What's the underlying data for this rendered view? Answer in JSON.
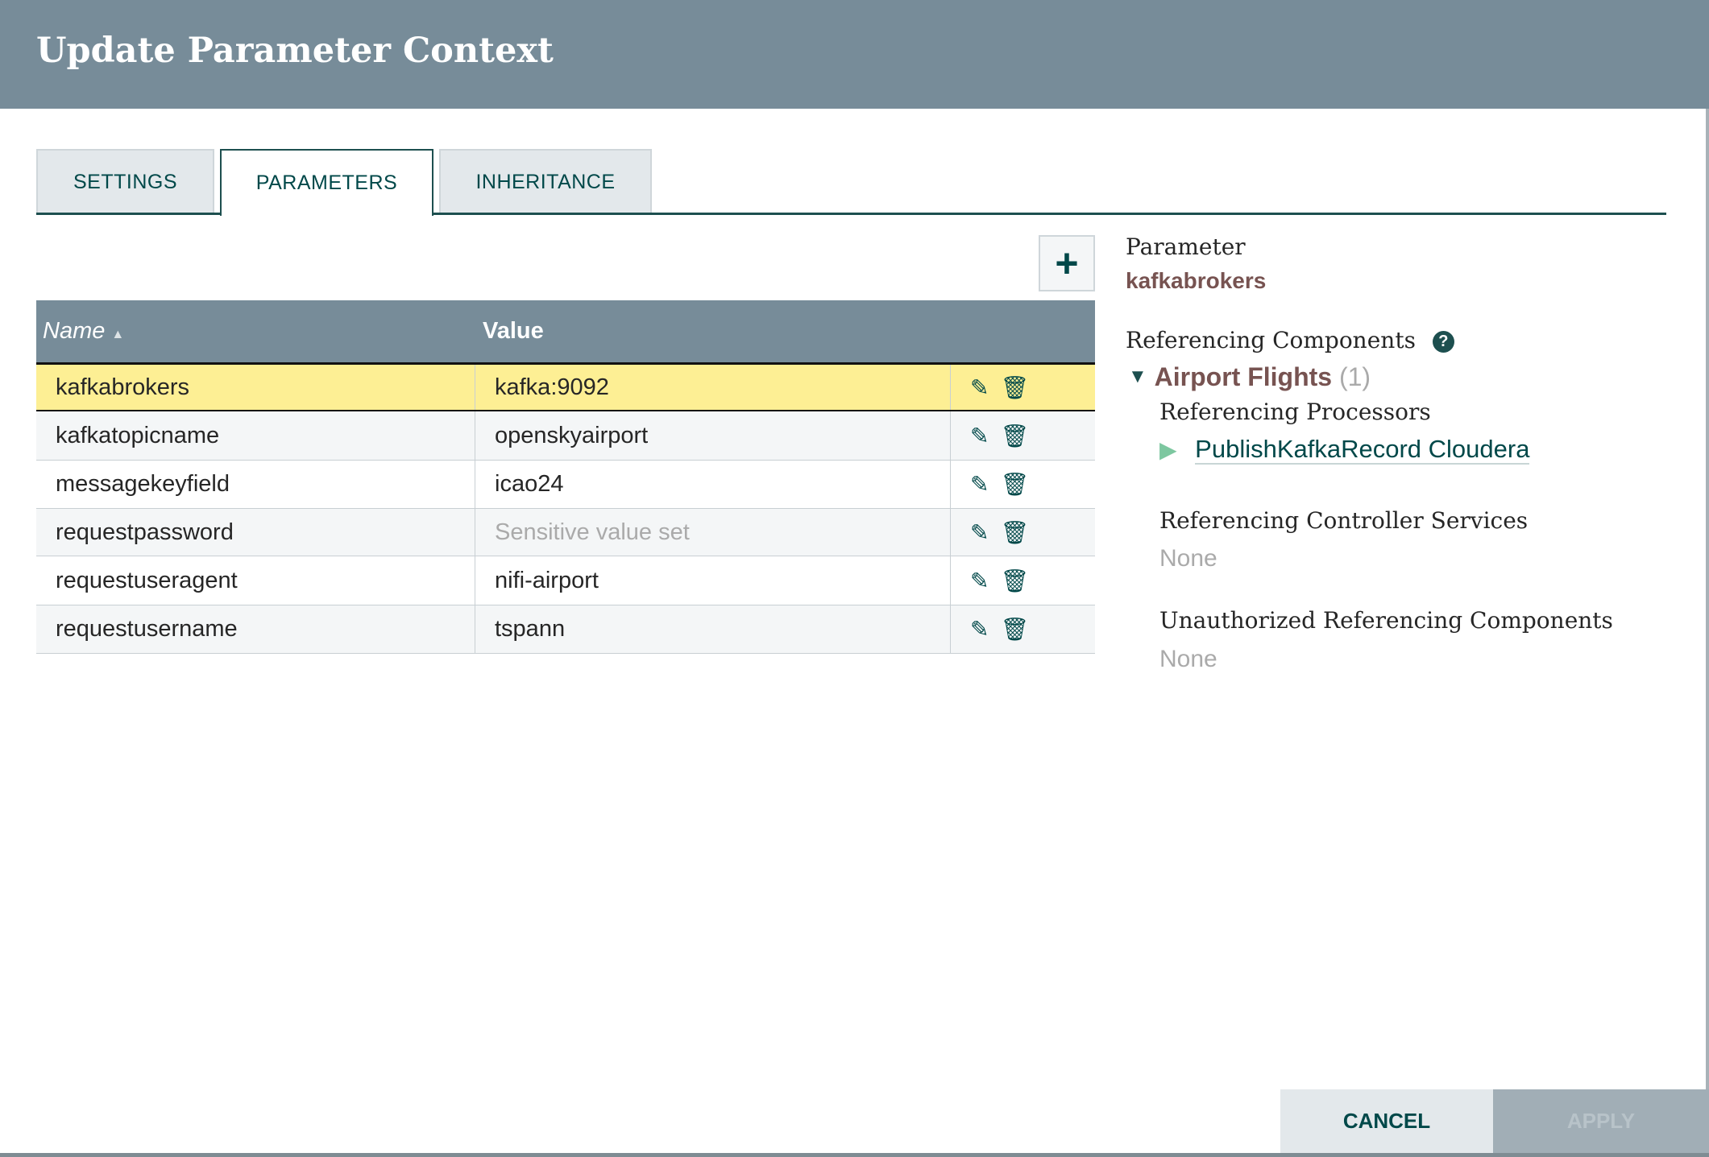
{
  "dialog": {
    "title": "Update Parameter Context"
  },
  "tabs": [
    {
      "label": "SETTINGS"
    },
    {
      "label": "PARAMETERS"
    },
    {
      "label": "INHERITANCE"
    }
  ],
  "add_icon": "plus-icon",
  "table": {
    "columns": {
      "name": "Name",
      "value": "Value"
    },
    "rows": [
      {
        "name": "kafkabrokers",
        "value": "kafka:9092"
      },
      {
        "name": "kafkatopicname",
        "value": "openskyairport"
      },
      {
        "name": "messagekeyfield",
        "value": "icao24"
      },
      {
        "name": "requestpassword",
        "value": "Sensitive value set"
      },
      {
        "name": "requestuseragent",
        "value": "nifi-airport"
      },
      {
        "name": "requestusername",
        "value": "tspann"
      }
    ]
  },
  "details": {
    "parameter_label": "Parameter",
    "parameter_name": "kafkabrokers",
    "ref_components_label": "Referencing Components",
    "group_name": "Airport Flights",
    "group_count": "(1)",
    "ref_processors_label": "Referencing Processors",
    "processor_name": "PublishKafkaRecord Cloudera",
    "ref_services_label": "Referencing Controller Services",
    "ref_services_value": "None",
    "unauth_label": "Unauthorized Referencing Components",
    "unauth_value": "None"
  },
  "footer": {
    "cancel": "CANCEL",
    "apply": "APPLY"
  },
  "colors": {
    "header": "#778c99",
    "accent": "#004849",
    "selected_row": "#fdef94",
    "brown": "#775351"
  }
}
